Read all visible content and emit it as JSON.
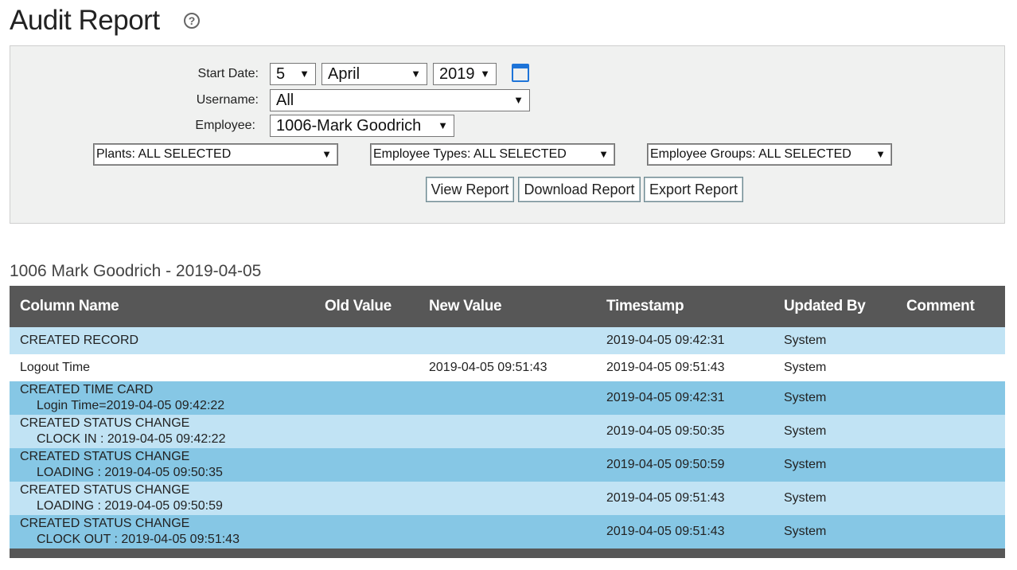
{
  "header": {
    "title": "Audit Report",
    "help_icon": "?"
  },
  "filters": {
    "start_date_label": "Start Date:",
    "day": "5",
    "month": "April",
    "year": "2019",
    "calendar_icon": "calendar-icon",
    "username_label": "Username:",
    "username": "All",
    "employee_label": "Employee:",
    "employee": "1006-Mark Goodrich",
    "plants": "Plants: ALL SELECTED",
    "employee_types": "Employee Types: ALL SELECTED",
    "employee_groups": "Employee Groups: ALL SELECTED",
    "arrow": "▼"
  },
  "buttons": {
    "view": "View Report",
    "download": "Download Report",
    "export": "Export Report"
  },
  "report": {
    "title": "1006 Mark Goodrich - 2019-04-05",
    "columns": [
      "Column Name",
      "Old Value",
      "New Value",
      "Timestamp",
      "Updated By",
      "Comment"
    ],
    "rows": [
      {
        "name": "CREATED RECORD",
        "sub": "",
        "old": "",
        "new": "",
        "timestamp": "2019-04-05 09:42:31",
        "by": "System",
        "comment": ""
      },
      {
        "name": "Logout Time",
        "sub": "",
        "old": "",
        "new": "2019-04-05 09:51:43",
        "timestamp": "2019-04-05 09:51:43",
        "by": "System",
        "comment": ""
      },
      {
        "name": "CREATED TIME CARD",
        "sub": "Login Time=2019-04-05 09:42:22",
        "old": "",
        "new": "",
        "timestamp": "2019-04-05 09:42:31",
        "by": "System",
        "comment": ""
      },
      {
        "name": "CREATED STATUS CHANGE",
        "sub": "CLOCK IN : 2019-04-05 09:42:22",
        "old": "",
        "new": "",
        "timestamp": "2019-04-05 09:50:35",
        "by": "System",
        "comment": ""
      },
      {
        "name": "CREATED STATUS CHANGE",
        "sub": "LOADING : 2019-04-05 09:50:35",
        "old": "",
        "new": "",
        "timestamp": "2019-04-05 09:50:59",
        "by": "System",
        "comment": ""
      },
      {
        "name": "CREATED STATUS CHANGE",
        "sub": "LOADING : 2019-04-05 09:50:59",
        "old": "",
        "new": "",
        "timestamp": "2019-04-05 09:51:43",
        "by": "System",
        "comment": ""
      },
      {
        "name": "CREATED STATUS CHANGE",
        "sub": "CLOCK OUT : 2019-04-05 09:51:43",
        "old": "",
        "new": "",
        "timestamp": "2019-04-05 09:51:43",
        "by": "System",
        "comment": ""
      }
    ]
  },
  "colors": {
    "header_bg": "#575757",
    "row_light": "#c1e3f4",
    "row_white": "#ffffff",
    "row_medium": "#86c7e5",
    "accent": "#1e74d8"
  }
}
